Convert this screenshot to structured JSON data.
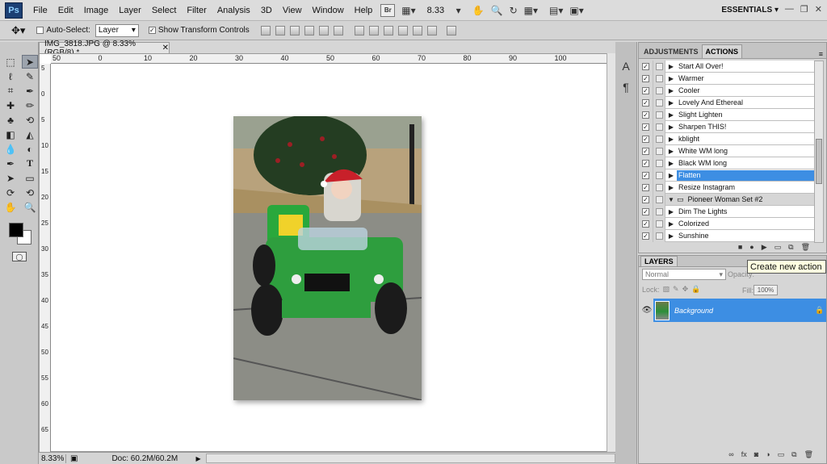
{
  "app": {
    "logo": "Ps"
  },
  "menu": [
    "File",
    "Edit",
    "Image",
    "Layer",
    "Select",
    "Filter",
    "Analysis",
    "3D",
    "View",
    "Window",
    "Help"
  ],
  "appbar": {
    "bridge_label": "Br",
    "zoom": "8.33",
    "workspace": "ESSENTIALS"
  },
  "options": {
    "auto_select_label": "Auto-Select:",
    "layer_select_value": "Layer",
    "show_transform_label": "Show Transform Controls"
  },
  "document": {
    "tab_title": "IMG_3818.JPG @ 8.33% (RGB/8) *",
    "ruler_h_labels": [
      "50",
      "0",
      "10",
      "20",
      "30",
      "40",
      "50",
      "60",
      "70",
      "80",
      "90",
      "100"
    ],
    "ruler_v_labels": [
      "5",
      "0",
      "5",
      "10",
      "15",
      "20",
      "25",
      "30",
      "35",
      "40",
      "45",
      "50",
      "55",
      "60",
      "65"
    ]
  },
  "status": {
    "zoom": "8.33%",
    "doc_size": "Doc: 60.2M/60.2M"
  },
  "actions_panel": {
    "tabs": [
      "ADJUSTMENTS",
      "ACTIONS"
    ],
    "items": [
      {
        "name": "Start All Over!",
        "type": "action"
      },
      {
        "name": "Warmer",
        "type": "action"
      },
      {
        "name": "Cooler",
        "type": "action"
      },
      {
        "name": "Lovely And Ethereal",
        "type": "action"
      },
      {
        "name": "Slight Lighten",
        "type": "action"
      },
      {
        "name": "Sharpen THIS!",
        "type": "action"
      },
      {
        "name": "kblight",
        "type": "action"
      },
      {
        "name": "White WM long",
        "type": "action"
      },
      {
        "name": "Black WM long",
        "type": "action"
      },
      {
        "name": "Flatten",
        "type": "action",
        "selected": true
      },
      {
        "name": "Resize Instagram",
        "type": "action"
      },
      {
        "name": "Pioneer Woman Set #2",
        "type": "set"
      },
      {
        "name": "Dim The Lights",
        "type": "action"
      },
      {
        "name": "Colorized",
        "type": "action"
      },
      {
        "name": "Sunshine",
        "type": "action"
      }
    ],
    "tooltip": "Create new action"
  },
  "layers_panel": {
    "tab": "LAYERS",
    "blend_mode": "Normal",
    "opacity_label": "Opacity:",
    "lock_label": "Lock:",
    "fill_label": "Fill:",
    "fill_value": "100%",
    "layer_name": "Background"
  }
}
